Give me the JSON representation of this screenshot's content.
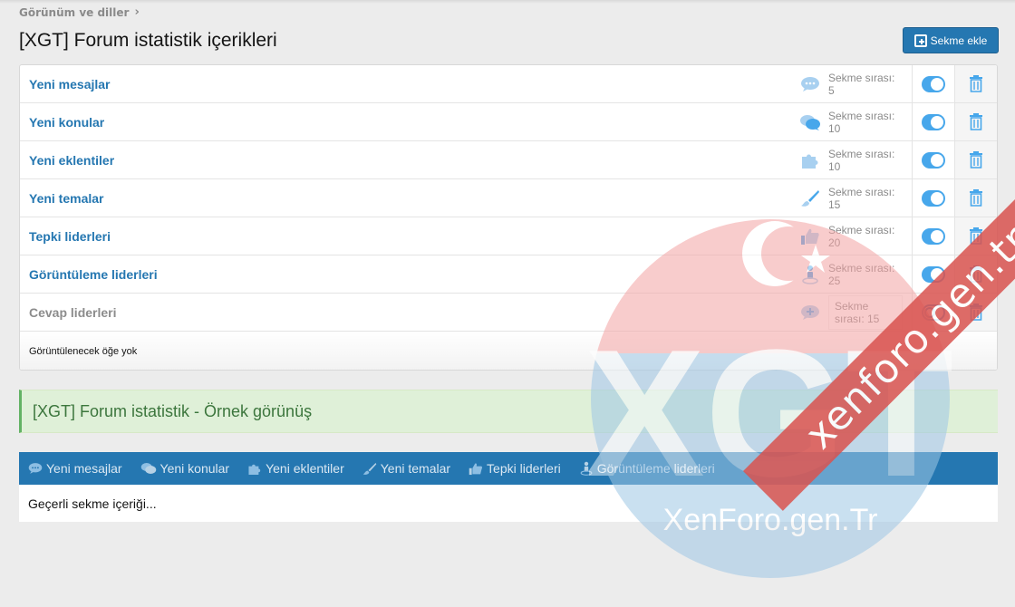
{
  "breadcrumb": {
    "label": "Görünüm ve diller"
  },
  "page": {
    "title": "[XGT] Forum istatistik içerikleri"
  },
  "toolbar": {
    "add_label": "Sekme ekle"
  },
  "tabs_list": {
    "items": [
      {
        "name": "Yeni mesajlar",
        "order": "Sekme sırası: 5",
        "icon": "comment-dots-icon",
        "enabled": true
      },
      {
        "name": "Yeni konular",
        "order": "Sekme sırası: 10",
        "icon": "comments-icon",
        "enabled": true
      },
      {
        "name": "Yeni eklentiler",
        "order": "Sekme sırası: 10",
        "icon": "puzzle-icon",
        "enabled": true
      },
      {
        "name": "Yeni temalar",
        "order": "Sekme sırası: 15",
        "icon": "paint-brush-icon",
        "enabled": true
      },
      {
        "name": "Tepki liderleri",
        "order": "Sekme sırası: 20",
        "icon": "thumbs-up-icon",
        "enabled": true
      },
      {
        "name": "Görüntüleme liderleri",
        "order": "Sekme sırası: 25",
        "icon": "street-view-icon",
        "enabled": true
      },
      {
        "name": "Cevap liderleri",
        "order": "Sekme sırası: 15",
        "icon": "comment-plus-icon",
        "enabled": false
      }
    ],
    "footer": "Görüntülenecek öğe yok"
  },
  "preview": {
    "title": "[XGT] Forum istatistik - Örnek görünüş",
    "tabs": [
      {
        "label": "Yeni mesajlar",
        "icon": "comment-dots-icon"
      },
      {
        "label": "Yeni konular",
        "icon": "comments-icon"
      },
      {
        "label": "Yeni eklentiler",
        "icon": "puzzle-icon"
      },
      {
        "label": "Yeni temalar",
        "icon": "paint-brush-icon"
      },
      {
        "label": "Tepki liderleri",
        "icon": "thumbs-up-icon"
      },
      {
        "label": "Görüntüleme liderleri",
        "icon": "street-view-icon"
      }
    ],
    "content": "Geçerli sekme içeriği..."
  },
  "watermark": {
    "logo_text": "XGT",
    "sub_text": "XenForo.gen.Tr",
    "ribbon": "xenforo.gen.tr"
  },
  "colors": {
    "accent": "#2577b1",
    "toggle": "#47a7eb",
    "success_bg": "#dff0d8",
    "success_text": "#3c763d"
  }
}
